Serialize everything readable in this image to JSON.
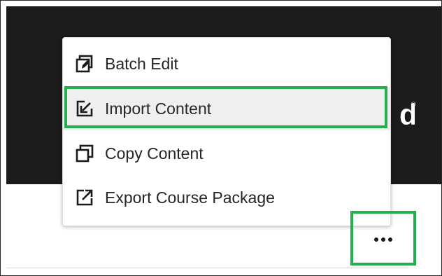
{
  "menu": {
    "items": [
      {
        "label": "Batch Edit",
        "icon": "batch-edit-icon"
      },
      {
        "label": "Import Content",
        "icon": "import-content-icon",
        "highlighted": true
      },
      {
        "label": "Copy Content",
        "icon": "copy-content-icon"
      },
      {
        "label": "Export Course Package",
        "icon": "export-icon"
      }
    ]
  },
  "banner": {
    "logo_fragment": "d",
    "logo_mark": "®"
  },
  "more_button": {
    "icon": "more-horizontal-icon"
  },
  "colors": {
    "banner": "#1c1c1c",
    "highlight": "#22b14c",
    "hover_row": "#efefef",
    "text": "#262626"
  }
}
